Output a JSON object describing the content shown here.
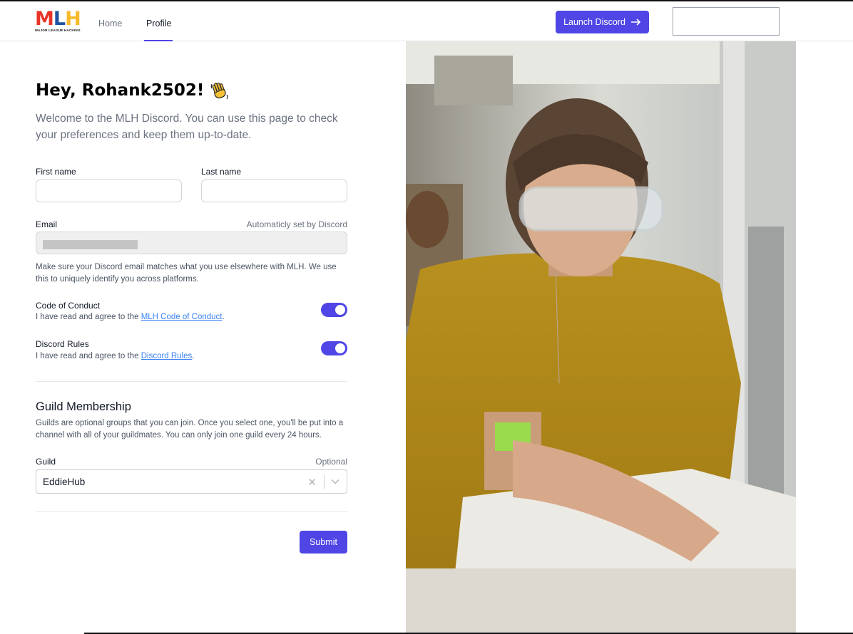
{
  "header": {
    "logo_text": "MLH",
    "logo_tagline": "MAJOR LEAGUE HACKING",
    "nav": {
      "home": "Home",
      "profile": "Profile"
    },
    "launch_button": "Launch Discord"
  },
  "main": {
    "greeting": "Hey, Rohank2502!",
    "intro": "Welcome to the MLH Discord. You can use this page to check your preferences and keep them up-to-date.",
    "first_name": {
      "label": "First name",
      "value": ""
    },
    "last_name": {
      "label": "Last name",
      "value": ""
    },
    "email": {
      "label": "Email",
      "hint": "Automaticly set by Discord",
      "help": "Make sure your Discord email matches what you use elsewhere with MLH. We use this to uniquely identify you across platforms."
    },
    "code_of_conduct": {
      "title": "Code of Conduct",
      "text_prefix": "I have read and agree to the ",
      "link": "MLH Code of Conduct",
      "text_suffix": ".",
      "enabled": true
    },
    "discord_rules": {
      "title": "Discord Rules",
      "text_prefix": "I have read and agree to the ",
      "link": "Discord Rules",
      "text_suffix": ".",
      "enabled": true
    },
    "guild_section": {
      "title": "Guild Membership",
      "description": "Guilds are optional groups that you can join. Once you select one, you'll be put into a channel with all of your guildmates. You can only join one guild every 24 hours.",
      "label": "Guild",
      "hint": "Optional",
      "selected": "EddieHub"
    },
    "submit": "Submit"
  },
  "colors": {
    "accent": "#4f46e5",
    "link": "#3b82f6",
    "logo_m": "#e73427",
    "logo_l": "#1d539f",
    "logo_h": "#f8b92a"
  },
  "icons": {
    "wave": "waving-hand-icon",
    "arrow": "arrow-right-icon",
    "clear": "close-icon",
    "chevron": "chevron-down-icon"
  }
}
